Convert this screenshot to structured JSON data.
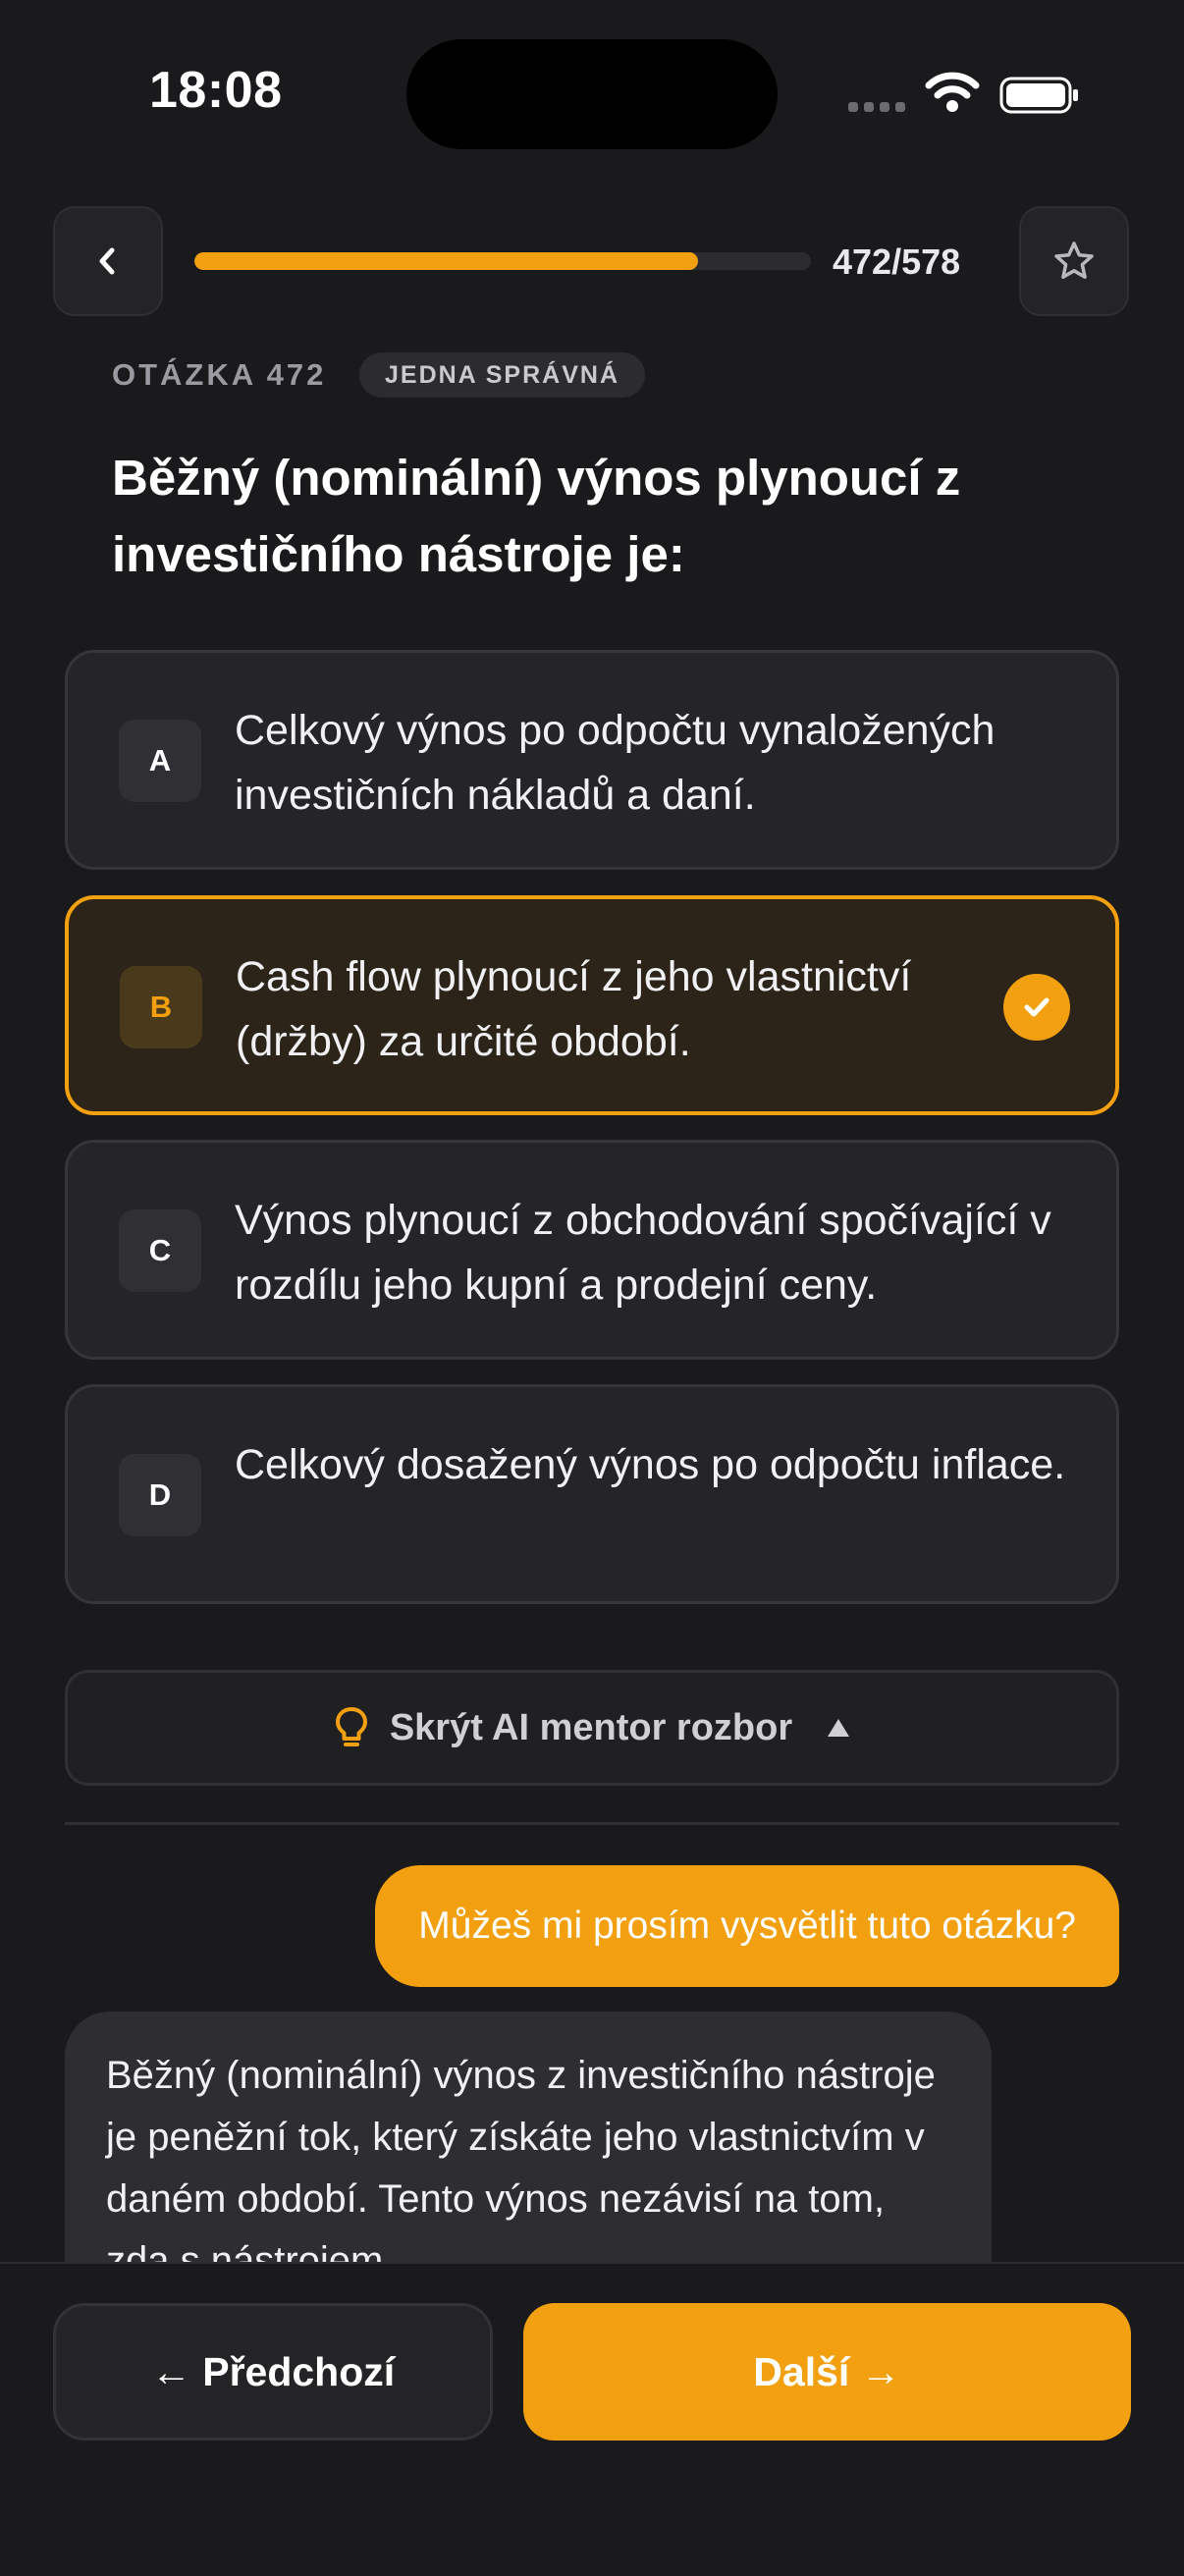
{
  "status_bar": {
    "time": "18:08"
  },
  "progress": {
    "current": 472,
    "total": 578,
    "label": "472/578",
    "fraction": 0.817
  },
  "question": {
    "number_label": "OTÁZKA 472",
    "type_badge": "JEDNA SPRÁVNÁ",
    "text": "Běžný (nominální) výnos plynoucí z investičního nástroje je:"
  },
  "options": [
    {
      "letter": "A",
      "text": "Celkový výnos po odpočtu vynaložených investičních nákladů a daní.",
      "selected": false
    },
    {
      "letter": "B",
      "text": "Cash flow plynoucí z jeho vlastnictví (držby) za určité období.",
      "selected": true
    },
    {
      "letter": "C",
      "text": "Výnos plynoucí z obchodování spočívající v rozdílu jeho kupní a prodejní ceny.",
      "selected": false
    },
    {
      "letter": "D",
      "text": "Celkový dosažený výnos po odpočtu inflace.",
      "selected": false
    }
  ],
  "ai_mentor": {
    "toggle_label": "Skrýt AI mentor rozbor",
    "user_message": "Můžeš mi prosím vysvětlit tuto otázku?",
    "ai_message": "Běžný (nominální) výnos z investičního nástroje je peněžní tok, který získáte jeho vlastnictvím v daném období. Tento výnos nezávisí na tom, zda s nástrojem"
  },
  "nav": {
    "prev_label": "← Předchozí",
    "next_label": "Další →"
  },
  "icons": {
    "back": "chevron-left-icon",
    "favorite": "star-icon",
    "hint": "lightbulb-icon",
    "selected": "checkmark-icon",
    "toggle": "caret-up-icon"
  },
  "colors": {
    "accent": "#f2a00f",
    "background": "#1a1a1c",
    "card": "#252528"
  }
}
